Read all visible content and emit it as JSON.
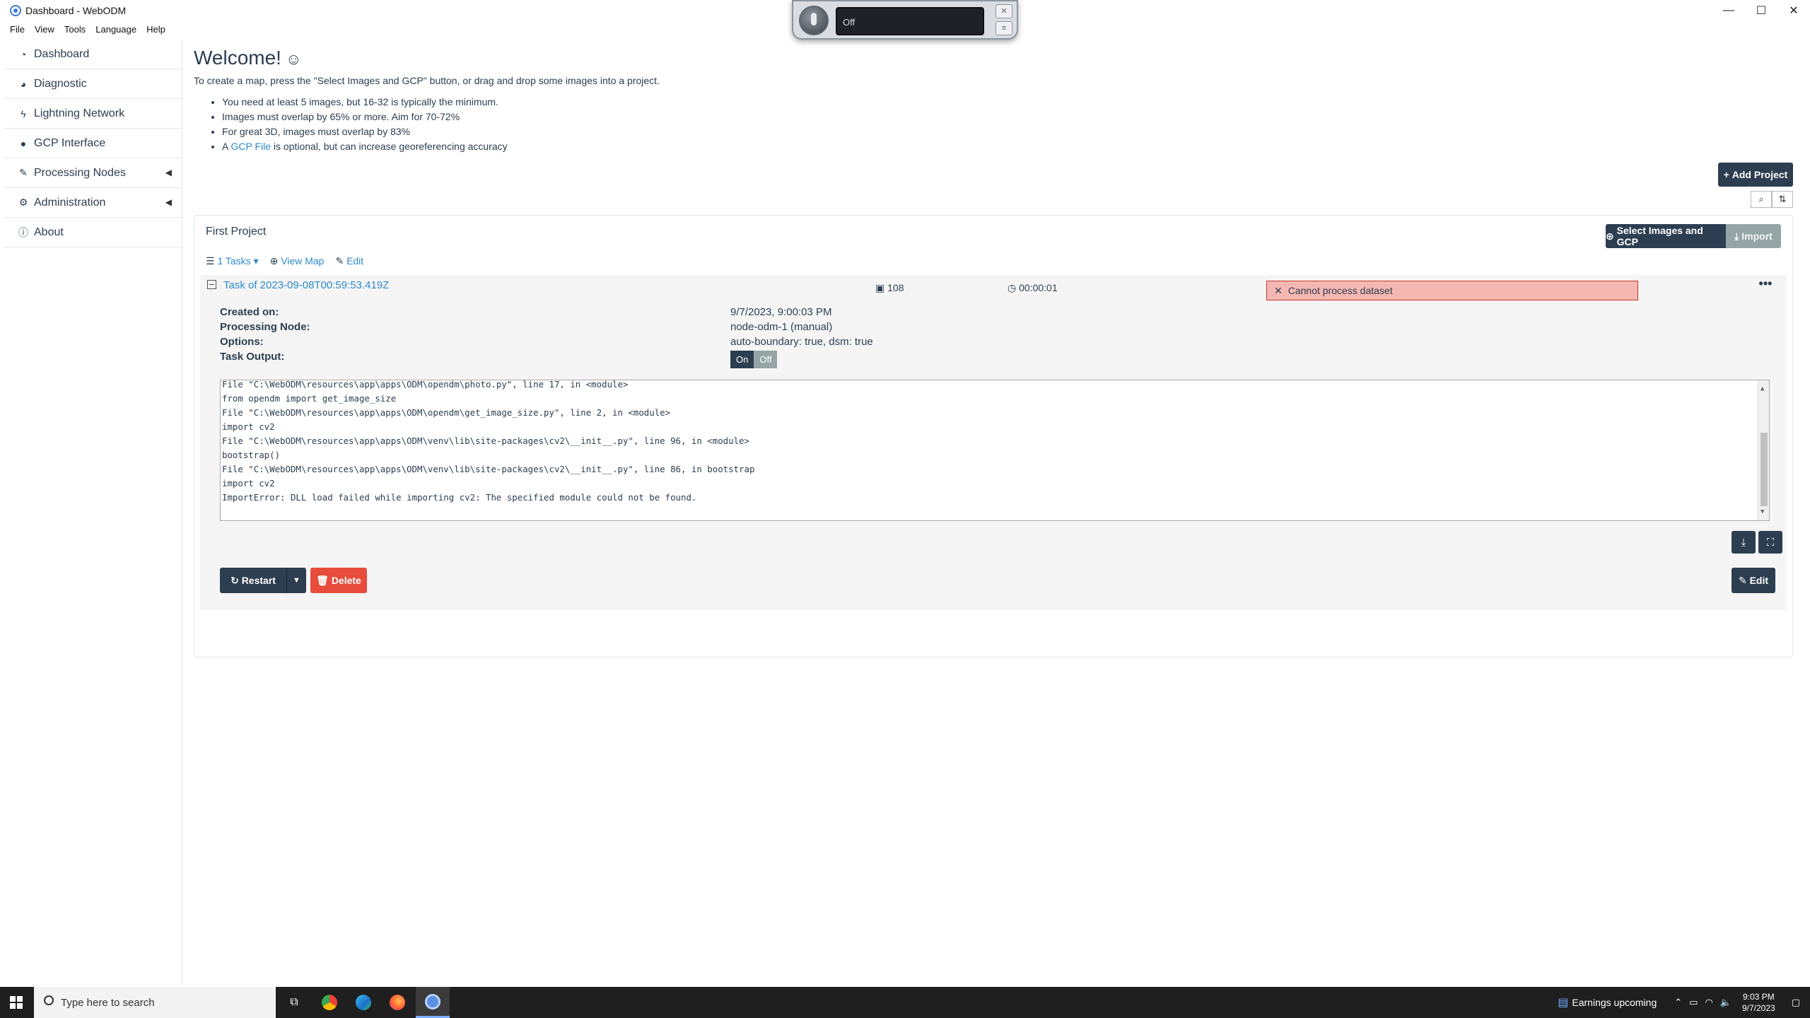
{
  "window": {
    "title": "Dashboard - WebODM",
    "controls": {
      "minimize": "—",
      "maximize": "☐",
      "close": "✕"
    }
  },
  "menu": [
    "File",
    "View",
    "Tools",
    "Language",
    "Help"
  ],
  "recorder": {
    "status": "Off"
  },
  "sidebar": {
    "items": [
      {
        "label": "Dashboard",
        "icon": "dashboard-icon"
      },
      {
        "label": "Diagnostic",
        "icon": "pie-chart-icon"
      },
      {
        "label": "Lightning Network",
        "icon": "bolt-icon"
      },
      {
        "label": "GCP Interface",
        "icon": "map-marker-icon"
      },
      {
        "label": "Processing Nodes",
        "icon": "wrench-icon"
      },
      {
        "label": "Administration",
        "icon": "cogs-icon"
      },
      {
        "label": "About",
        "icon": "info-icon"
      }
    ]
  },
  "welcome": {
    "title": "Welcome!",
    "smile": "☺",
    "intro": "To create a map, press the \"Select Images and GCP\" button, or drag and drop some images into a project.",
    "tips": [
      "You need at least 5 images, but 16-32 is typically the minimum.",
      "Images must overlap by 65% or more. Aim for 70-72%",
      "For great 3D, images must overlap by 83%"
    ],
    "gcp_prefix": "A ",
    "gcp_link": "GCP File",
    "gcp_suffix": " is optional, but can increase georeferencing accuracy"
  },
  "buttons": {
    "add_project": "Add Project",
    "select_images": "Select Images and GCP",
    "import": "Import",
    "restart": "Restart",
    "delete": "Delete",
    "edit": "Edit"
  },
  "project": {
    "name": "First Project",
    "tasks_link": "1 Tasks",
    "view_map": "View Map",
    "edit": "Edit"
  },
  "task": {
    "name": "Task of 2023-09-08T00:59:53.419Z",
    "images": "108",
    "duration": "00:00:01",
    "error": "Cannot process dataset",
    "more": "•••",
    "labels": {
      "created": "Created on:",
      "node": "Processing Node:",
      "options": "Options:",
      "output": "Task Output:"
    },
    "values": {
      "created": "9/7/2023, 9:00:03 PM",
      "node": "node-odm-1 (manual)",
      "options": "auto-boundary: true, dsm: true"
    },
    "output_on": "On",
    "output_off": "Off",
    "console": [
      "File \"C:\\WebODM\\resources\\app\\apps\\ODM\\opendm\\photo.py\", line 17, in <module>",
      "from opendm import get_image_size",
      "File \"C:\\WebODM\\resources\\app\\apps\\ODM\\opendm\\get_image_size.py\", line 2, in <module>",
      "import cv2",
      "File \"C:\\WebODM\\resources\\app\\apps\\ODM\\venv\\lib\\site-packages\\cv2\\__init__.py\", line 96, in <module>",
      "bootstrap()",
      "File \"C:\\WebODM\\resources\\app\\apps\\ODM\\venv\\lib\\site-packages\\cv2\\__init__.py\", line 86, in bootstrap",
      "import cv2",
      "ImportError: DLL load failed while importing cv2: The specified module could not be found."
    ]
  },
  "taskbar": {
    "search_placeholder": "Type here to search",
    "news": "Earnings upcoming",
    "time": "9:03 PM",
    "date": "9/7/2023"
  },
  "colors": {
    "primary": "#2c3e50",
    "link": "#2d8acb",
    "danger": "#e74c3c",
    "error_bg": "#f5b7b1",
    "muted": "#95a5a6"
  }
}
